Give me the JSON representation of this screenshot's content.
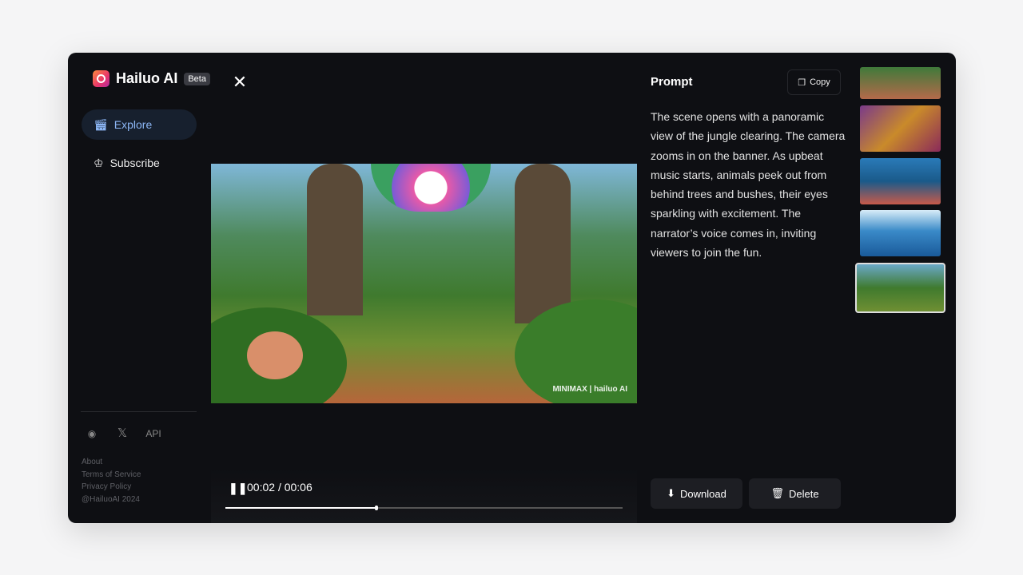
{
  "brand": {
    "name": "Hailuo AI",
    "badge": "Beta"
  },
  "sidebar": {
    "items": [
      {
        "label": "Explore",
        "icon": "clapperboard-icon",
        "active": true
      },
      {
        "label": "Subscribe",
        "icon": "crown-icon",
        "active": false
      }
    ],
    "social": [
      {
        "icon": "discord-icon"
      },
      {
        "icon": "x-icon"
      },
      {
        "label": "API"
      }
    ],
    "links": [
      "About",
      "Terms of Service",
      "Privacy Policy",
      "@HailuoAI 2024"
    ]
  },
  "player": {
    "current": "00:02",
    "duration": "00:06",
    "time_sep": "/",
    "progress": 0.38,
    "watermark": "MINIMAX | hailuo AI"
  },
  "prompt": {
    "title": "Prompt",
    "copy_label": "Copy",
    "text": "The scene opens with a panoramic view of the jungle clearing. The camera zooms in on the banner. As upbeat music starts, animals peek out from behind trees and bushes, their eyes sparkling with excitement. The narrator’s voice comes in, inviting viewers to join the fun."
  },
  "actions": {
    "download": "Download",
    "delete": "Delete"
  },
  "colors": {
    "accent": "#8cb6f5",
    "background": "#0e0f13"
  }
}
